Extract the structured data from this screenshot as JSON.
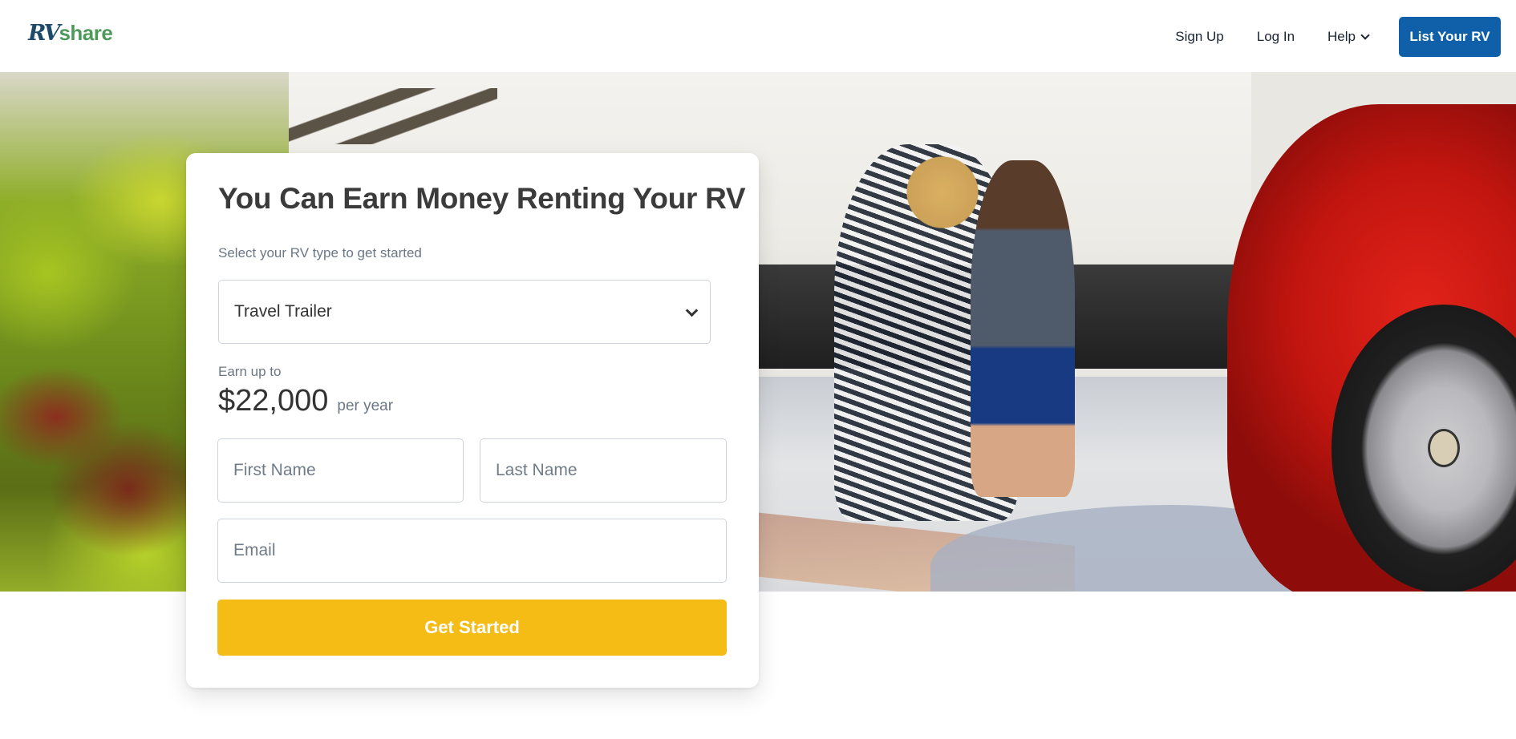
{
  "header": {
    "logo": {
      "part1": "RV",
      "part2": "share"
    },
    "nav": {
      "sign_up": "Sign Up",
      "log_in": "Log In",
      "help": "Help",
      "list_rv": "List Your RV"
    }
  },
  "hero": {
    "image_alt": "Mother and son hugging in a camping chair beside an RV, with a red car parked nearby"
  },
  "card": {
    "title": "You Can Earn Money Renting Your RV",
    "subtitle": "Select your RV type to get started",
    "rv_type": {
      "selected": "Travel Trailer"
    },
    "earn_label": "Earn up to",
    "earn_amount": "$22,000",
    "earn_period": "per year",
    "fields": {
      "first_name_placeholder": "First Name",
      "last_name_placeholder": "Last Name",
      "email_placeholder": "Email"
    },
    "cta_label": "Get Started"
  },
  "colors": {
    "brand_blue": "#0f60a8",
    "logo_navy": "#1b4a6b",
    "logo_green": "#4e9a5c",
    "cta_yellow": "#f5bc15"
  }
}
